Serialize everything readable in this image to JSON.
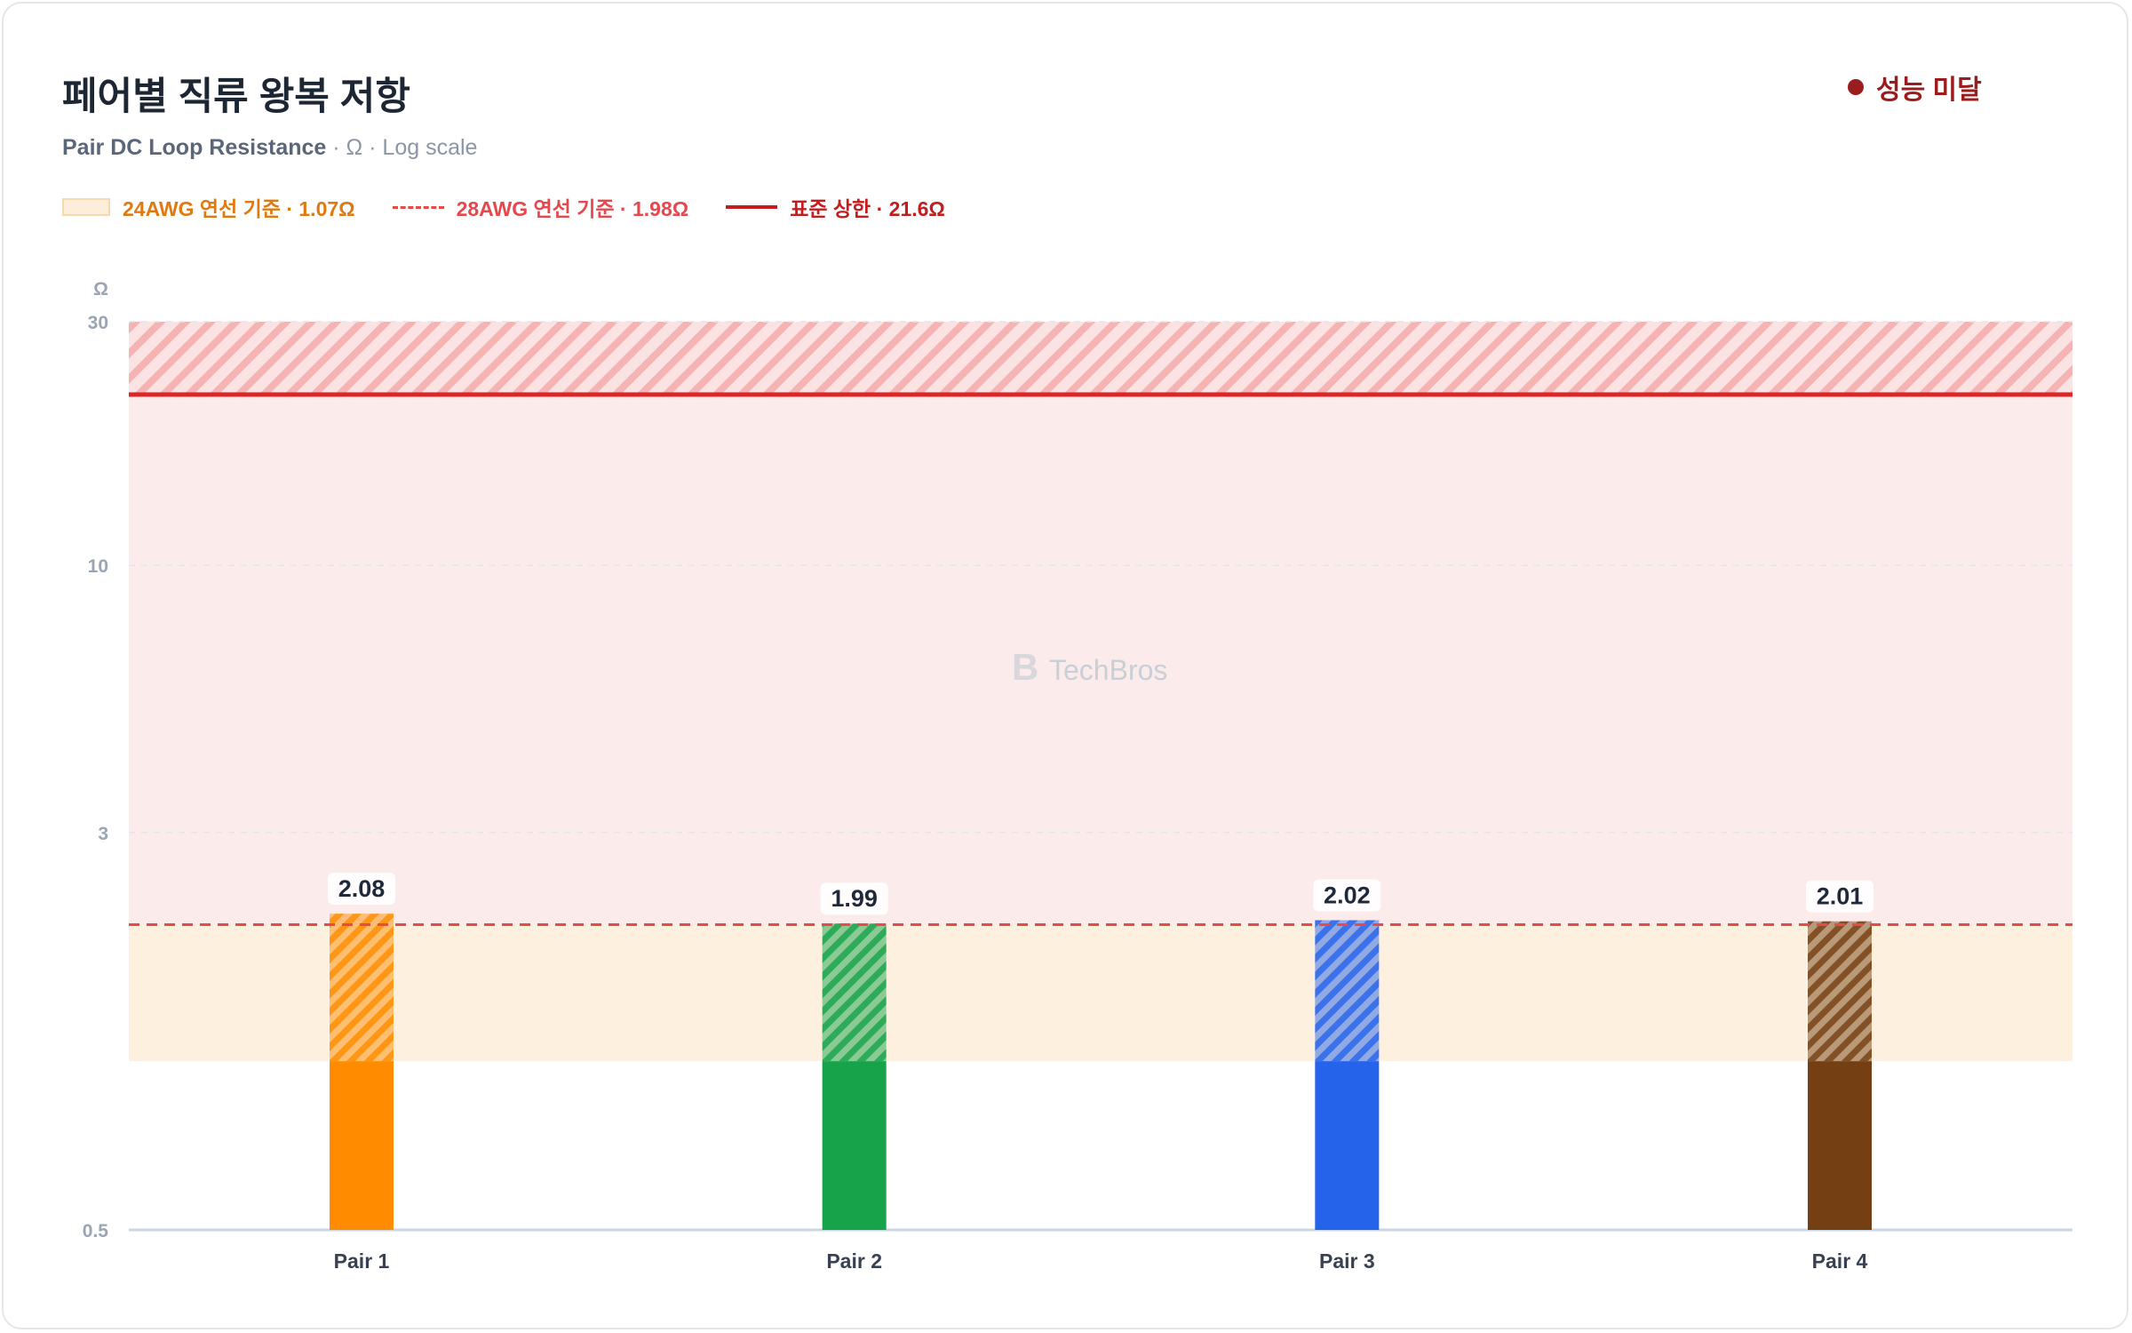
{
  "title": "페어별 직류 왕복 저항",
  "subtitle_main": "Pair DC Loop Resistance",
  "subtitle_rest": " · Ω · Log scale",
  "status": {
    "label": "성능 미달",
    "color": "#9b1c1c"
  },
  "legend": {
    "awg24": "24AWG 연선 기준 · 1.07Ω",
    "awg28": "28AWG 연선 기준 · 1.98Ω",
    "limit": "표준 상한 · 21.6Ω"
  },
  "watermark": "TechBros",
  "chart_data": {
    "type": "bar",
    "y_unit": "Ω",
    "y_scale": "log",
    "ylim": [
      0.5,
      30
    ],
    "yticks": [
      0.5,
      3,
      10,
      30
    ],
    "grid": true,
    "categories": [
      "Pair 1",
      "Pair 2",
      "Pair 3",
      "Pair 4"
    ],
    "values": [
      2.08,
      1.99,
      2.02,
      2.01
    ],
    "value_labels": [
      "2.08",
      "1.99",
      "2.02",
      "2.01"
    ],
    "bar_colors": [
      "#ff8c00",
      "#16a34a",
      "#2563eb",
      "#743f12"
    ],
    "reference_lines": {
      "awg24": {
        "value": 1.07,
        "color": "#fdeedb"
      },
      "awg28": {
        "value": 1.98,
        "color": "#e84a4a"
      },
      "limit": {
        "value": 21.6,
        "color": "#dc2626"
      }
    }
  }
}
